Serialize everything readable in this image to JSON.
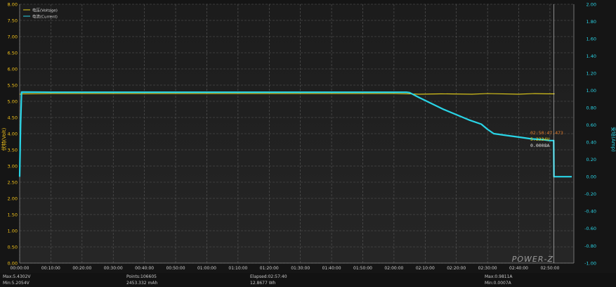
{
  "chart_data": {
    "type": "line",
    "title": "",
    "xlabel": "",
    "ylabel": "伏特(Volt)",
    "y2label": "安培(Amp)",
    "ylim": [
      0,
      8
    ],
    "y2lim": [
      -1,
      2
    ],
    "y_ticks": [
      "0.00",
      "0.50",
      "1.00",
      "1.50",
      "2.00",
      "2.50",
      "3.00",
      "3.50",
      "4.00",
      "4.50",
      "5.00",
      "5.50",
      "6.00",
      "6.50",
      "7.00",
      "7.50",
      "8.00"
    ],
    "y2_ticks": [
      "-1.00",
      "-0.80",
      "-0.60",
      "-0.40",
      "-0.20",
      "0.00",
      "0.20",
      "0.40",
      "0.60",
      "0.80",
      "1.00",
      "1.20",
      "1.40",
      "1.60",
      "1.80",
      "2.00"
    ],
    "x_ticks": [
      "00:00:00",
      "00:10:00",
      "00:20:00",
      "00:30:00",
      "00:40:00",
      "00:50:00",
      "01:00:00",
      "01:10:00",
      "01:20:00",
      "01:30:00",
      "01:40:00",
      "01:50:00",
      "02:00:00",
      "02:10:00",
      "02:20:00",
      "02:30:00",
      "02:40:00",
      "02:50:00"
    ],
    "grid": true,
    "legend_position": "top-left",
    "series": [
      {
        "name": "电压(Voltage)",
        "axis": "left",
        "color": "#e8d21a",
        "x": [
          0,
          0.5,
          10,
          30,
          60,
          90,
          120,
          125,
          128,
          135,
          145,
          150,
          160,
          165,
          170,
          171.5
        ],
        "values": [
          5.21,
          5.23,
          5.24,
          5.24,
          5.24,
          5.24,
          5.24,
          5.23,
          5.22,
          5.23,
          5.22,
          5.24,
          5.22,
          5.24,
          5.23,
          5.23
        ]
      },
      {
        "name": "电流(Current)",
        "axis": "left-current",
        "color": "#29d4e6",
        "x": [
          0,
          0.3,
          0.6,
          10,
          60,
          120,
          124,
          125,
          128,
          132,
          136,
          140,
          144,
          148,
          150,
          152,
          156,
          160,
          164,
          168,
          170,
          171.2,
          171.3,
          172,
          177
        ],
        "values": [
          0,
          0.6,
          0.982,
          0.98,
          0.98,
          0.98,
          0.98,
          0.975,
          0.92,
          0.85,
          0.78,
          0.72,
          0.66,
          0.61,
          0.55,
          0.5,
          0.48,
          0.46,
          0.44,
          0.43,
          0.42,
          0.42,
          0.0008,
          0.0008,
          0.0008
        ]
      }
    ],
    "annotations": {
      "cursor_time": "02:50:47.473",
      "cursor_voltage": "5.2334V",
      "cursor_current": "0.0008A"
    }
  },
  "footer": {
    "max_v": "Max:5.4302V",
    "min_v": "Min:5.2054V",
    "points": "Points:106605",
    "mah": "2453.332 mAh",
    "elapsed": "Elapsed:02:57:40",
    "wh": "12.8677 Wh",
    "max_a": "Max:0.9811A",
    "min_a": "Min:0.0007A"
  },
  "logo_text": "POWER-Z"
}
